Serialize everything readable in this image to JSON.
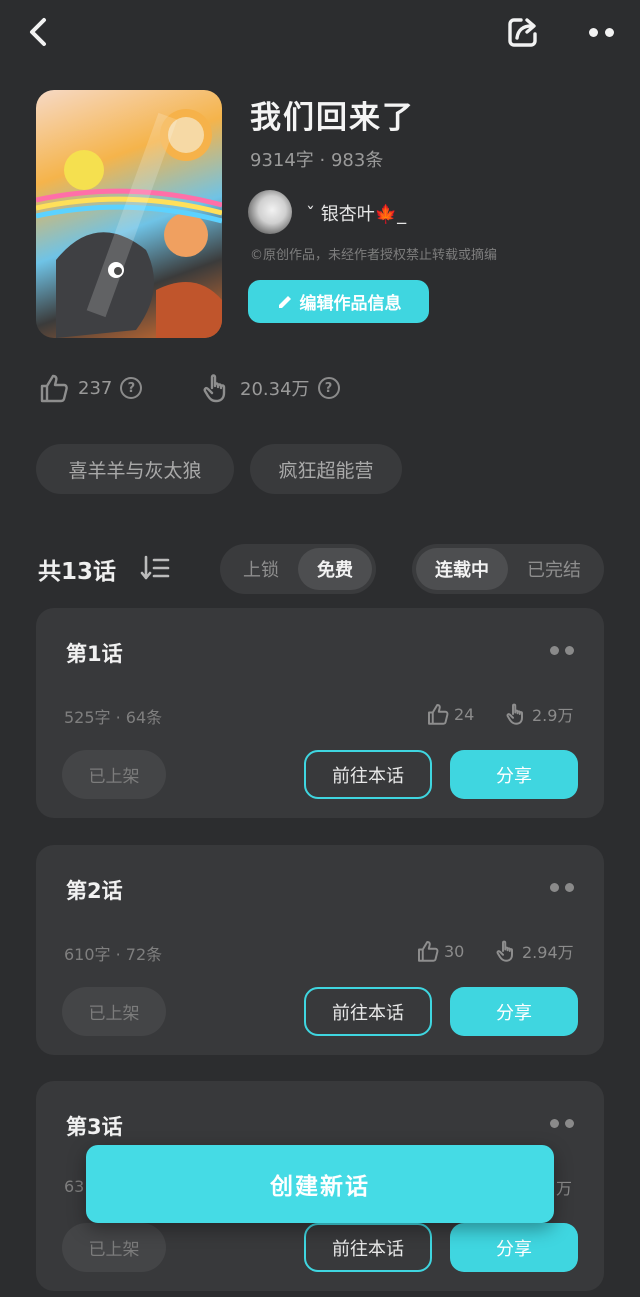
{
  "topbar": {
    "back_icon": "chevron-left-icon",
    "share_icon": "share-icon",
    "more_icon": "more-icon"
  },
  "work": {
    "title": "我们回来了",
    "stats": "9314字 · 983条",
    "author": "ˇ 银杏叶🍁_",
    "copyright": "©原创作品，未经作者授权禁止转载或摘编",
    "edit_label": "编辑作品信息"
  },
  "metrics": [
    {
      "icon": "thumbs-up-icon",
      "value": "237"
    },
    {
      "icon": "hand-pointer-icon",
      "value": "20.34万"
    }
  ],
  "tags": [
    "喜羊羊与灰太狼",
    "疯狂超能营"
  ],
  "episodes_header": {
    "count": "共13话",
    "sort_icon": "sort-list-icon",
    "filter_lock": {
      "options": [
        "上锁",
        "免费"
      ],
      "active": "免费"
    },
    "filter_status": {
      "options": [
        "连载中",
        "已完结"
      ],
      "active": "连载中"
    }
  },
  "episodes": [
    {
      "title": "第1话",
      "meta": "525字 · 64条",
      "likes": "24",
      "views": "2.9万",
      "status": "已上架",
      "goto_label": "前往本话",
      "share_label": "分享"
    },
    {
      "title": "第2话",
      "meta": "610字 · 72条",
      "likes": "30",
      "views": "2.94万",
      "status": "已上架",
      "goto_label": "前往本话",
      "share_label": "分享"
    },
    {
      "title": "第3话",
      "meta": "63",
      "likes": "",
      "views": "万",
      "status": "已上架",
      "goto_label": "前往本话",
      "share_label": "分享"
    }
  ],
  "create_label": "创建新话",
  "colors": {
    "accent": "#3fd6e0",
    "background": "#2c2d2f",
    "card": "#38393b"
  }
}
